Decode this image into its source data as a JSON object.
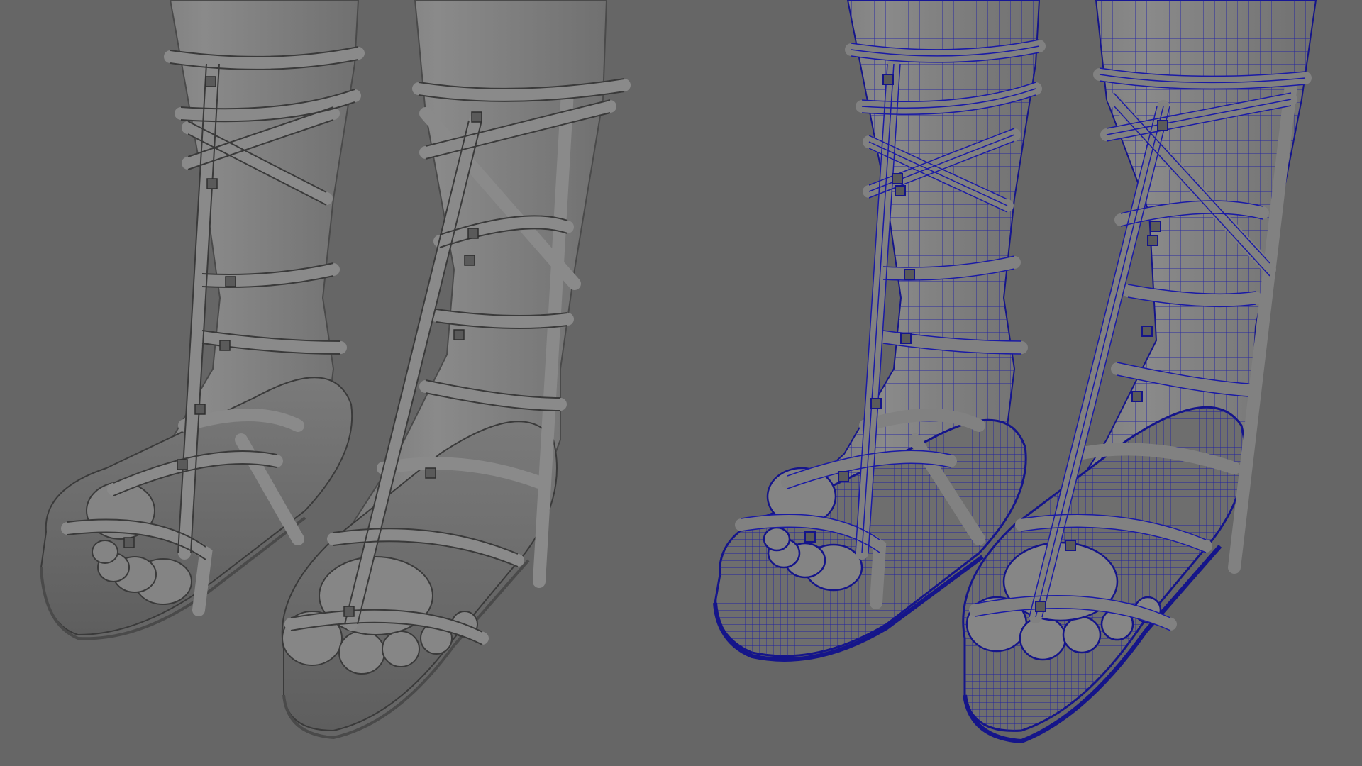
{
  "viewport": {
    "background_color": "#666666",
    "panels": [
      {
        "name": "shaded-smooth",
        "shading": "smooth-shaded",
        "fill_color": "#7c7c7c",
        "strap_color": "#858585",
        "outline_color": "#3a3a3a",
        "wireframe_color": null
      },
      {
        "name": "wireframe-on-shaded",
        "shading": "wireframe-on-shaded",
        "fill_color": "#7a7a7a",
        "strap_color": "#818181",
        "outline_color": "#15158a",
        "wireframe_color": "#1a1aa6"
      }
    ]
  }
}
